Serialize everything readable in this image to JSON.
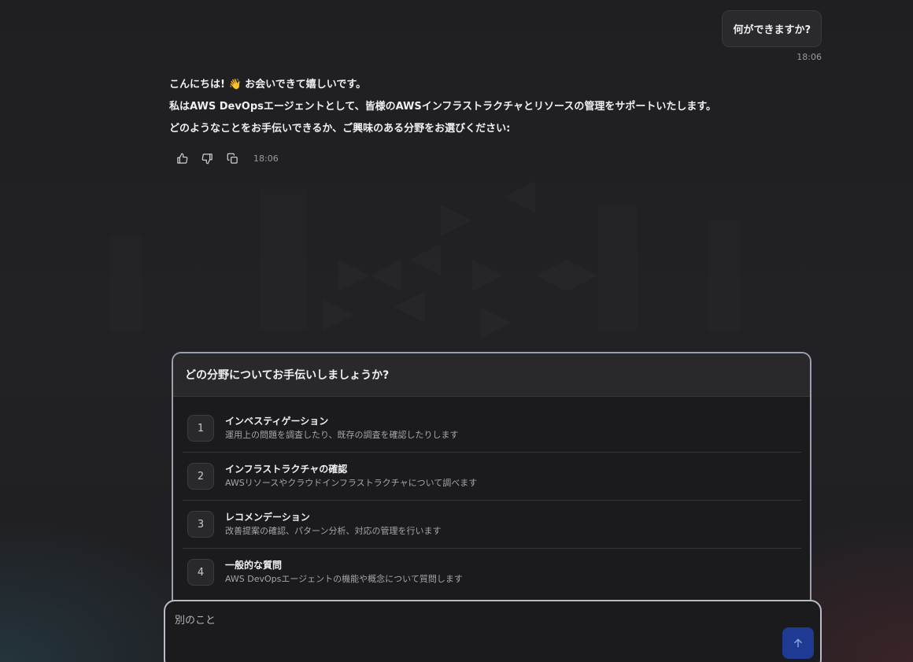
{
  "conversation": {
    "user_message": {
      "text": "何ができますか?",
      "time": "18:06"
    },
    "assistant_message": {
      "lines": [
        "こんにちは! 👋 お会いできて嬉しいです。",
        "私はAWS DevOpsエージェントとして、皆様のAWSインフラストラクチャとリソースの管理をサポートいたします。",
        "どのようなことをお手伝いできるか、ご興味のある分野をお選びください:"
      ],
      "time": "18:06",
      "actions": [
        {
          "name": "thumbs-up",
          "icon": "thumbs-up-icon"
        },
        {
          "name": "thumbs-down",
          "icon": "thumbs-down-icon"
        },
        {
          "name": "copy",
          "icon": "copy-icon"
        }
      ]
    }
  },
  "options_panel": {
    "title": "どの分野についてお手伝いしましょうか?",
    "options": [
      {
        "number": "1",
        "title": "インベスティゲーション",
        "description": "運用上の問題を調査したり、既存の調査を確認したりします"
      },
      {
        "number": "2",
        "title": "インフラストラクチャの確認",
        "description": "AWSリソースやクラウドインフラストラクチャについて調べます"
      },
      {
        "number": "3",
        "title": "レコメンデーション",
        "description": "改善提案の確認、パターン分析、対応の管理を行います"
      },
      {
        "number": "4",
        "title": "一般的な質問",
        "description": "AWS DevOpsエージェントの機能や概念について質問します"
      }
    ]
  },
  "input": {
    "placeholder": "別のこと",
    "value": ""
  },
  "colors": {
    "background": "#1e1e21",
    "panel_border": "#9aa0ad",
    "send_button": "#1f3a93"
  }
}
